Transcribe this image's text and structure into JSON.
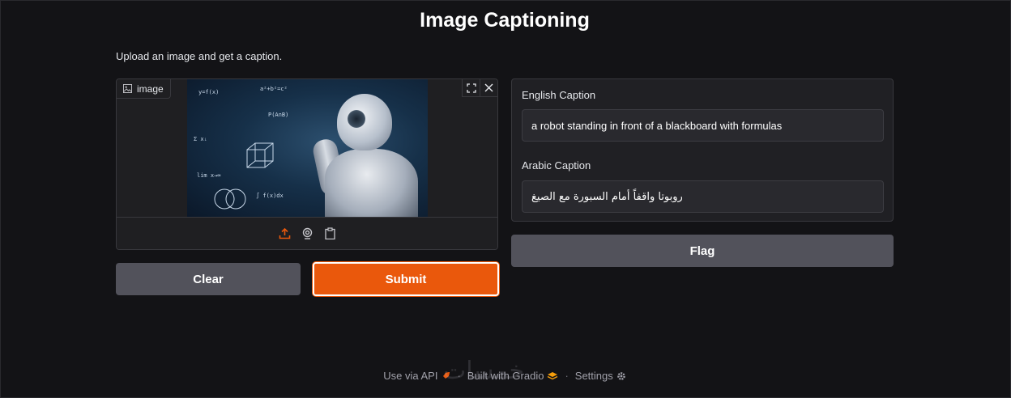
{
  "header": {
    "title": "Image Captioning",
    "description": "Upload an image and get a caption."
  },
  "image_input": {
    "label": "image",
    "label_icon": "image-icon",
    "preview_alt": "robot standing in front of a blackboard with formulas",
    "toolbar_icons": [
      "upload-icon",
      "webcam-icon",
      "clipboard-icon"
    ],
    "corner_icons": [
      "fullscreen-icon",
      "close-icon"
    ],
    "accent": "#ea580c"
  },
  "outputs": {
    "english_label": "English Caption",
    "english_value": "a robot standing in front of a blackboard with formulas",
    "arabic_label": "Arabic Caption",
    "arabic_value": "روبوتا واقفاً أمام السبورة مع الصيغ"
  },
  "buttons": {
    "clear": "Clear",
    "submit": "Submit",
    "flag": "Flag"
  },
  "footer": {
    "api": "Use via API",
    "built": "Built with Gradio",
    "settings": "Settings",
    "separator": "·"
  },
  "watermark": "خمسات",
  "colors": {
    "background": "#131316",
    "panel": "#202024",
    "submit": "#ea580c",
    "secondary_button": "#52525b"
  }
}
